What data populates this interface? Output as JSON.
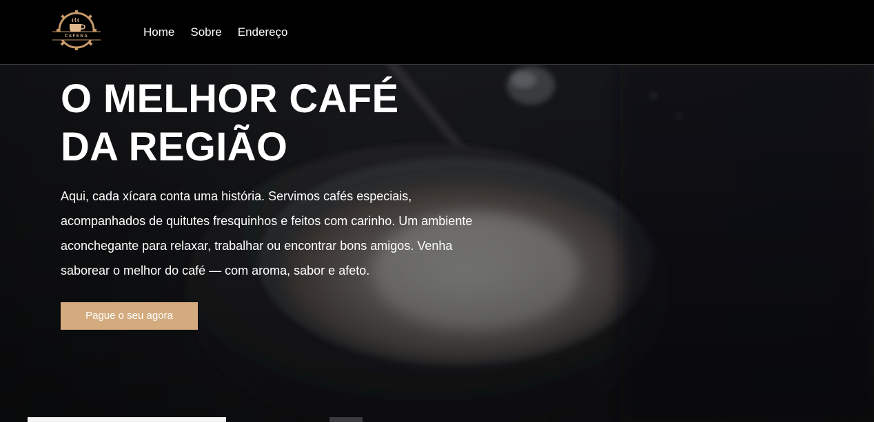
{
  "header": {
    "logo_text": "CAFENA",
    "nav": [
      {
        "label": "Home"
      },
      {
        "label": "Sobre"
      },
      {
        "label": "Endereço"
      }
    ]
  },
  "hero": {
    "title_line1": "O MELHOR CAFÉ",
    "title_line2": "DA REGIÃO",
    "description": "Aqui, cada xícara conta uma história. Servimos cafés especiais, acompanhados de quitutes fresquinhos e feitos com carinho. Um ambiente aconchegante para relaxar, trabalhar ou encontrar bons amigos. Venha saborear o melhor do café — com aroma, sabor e afeto.",
    "cta_label": "Pague o seu agora"
  },
  "colors": {
    "header_bg": "#000000",
    "accent": "#d4ab7f",
    "text": "#ffffff"
  }
}
